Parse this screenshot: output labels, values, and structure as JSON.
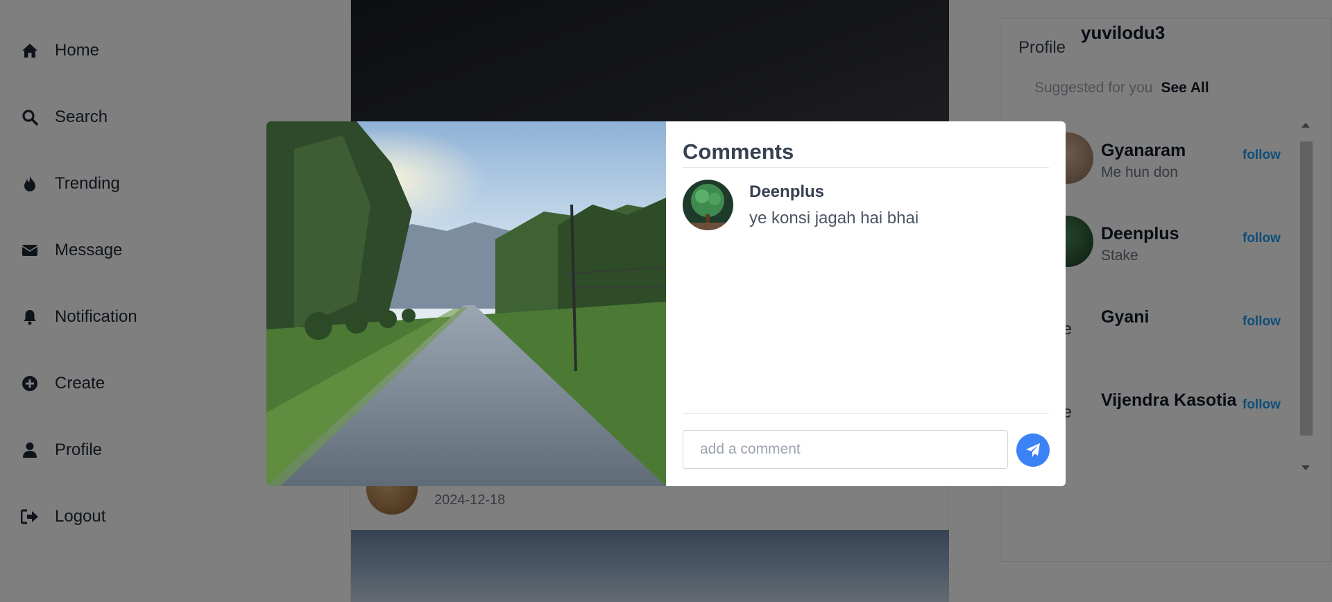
{
  "sidebar": {
    "items": [
      {
        "label": "Home",
        "icon": "home-icon"
      },
      {
        "label": "Search",
        "icon": "search-icon"
      },
      {
        "label": "Trending",
        "icon": "flame-icon"
      },
      {
        "label": "Message",
        "icon": "envelope-icon"
      },
      {
        "label": "Notification",
        "icon": "bell-icon"
      },
      {
        "label": "Create",
        "icon": "plus-circle-icon"
      },
      {
        "label": "Profile",
        "icon": "user-icon"
      },
      {
        "label": "Logout",
        "icon": "logout-icon"
      }
    ]
  },
  "feed": {
    "post_date": "2024-12-18"
  },
  "right_panel": {
    "profile_alt": "Profile",
    "username": "yuvilodu3",
    "suggested_title": "Suggested for you",
    "see_all": "See All",
    "suggestions": [
      {
        "name": "Gyanaram",
        "subtitle": "Me hun don",
        "follow": "follow",
        "avatar_alt": ""
      },
      {
        "name": "Deenplus",
        "subtitle": "Stake",
        "follow": "follow",
        "avatar_alt": ""
      },
      {
        "name": "Gyani",
        "subtitle": "",
        "follow": "follow",
        "avatar_alt": "Profile"
      },
      {
        "name": "Vijendra Kasotia",
        "subtitle": "",
        "follow": "follow",
        "avatar_alt": "Profile"
      }
    ]
  },
  "modal": {
    "title": "Comments",
    "comments": [
      {
        "user": "Deenplus",
        "text": "ye konsi jagah hai bhai"
      }
    ],
    "input_placeholder": "add a comment",
    "send_icon": "paper-plane-icon"
  },
  "colors": {
    "accent": "#3b82f6",
    "follow": "#1d9bf0",
    "overlay": "rgba(0,0,0,0.5)"
  }
}
